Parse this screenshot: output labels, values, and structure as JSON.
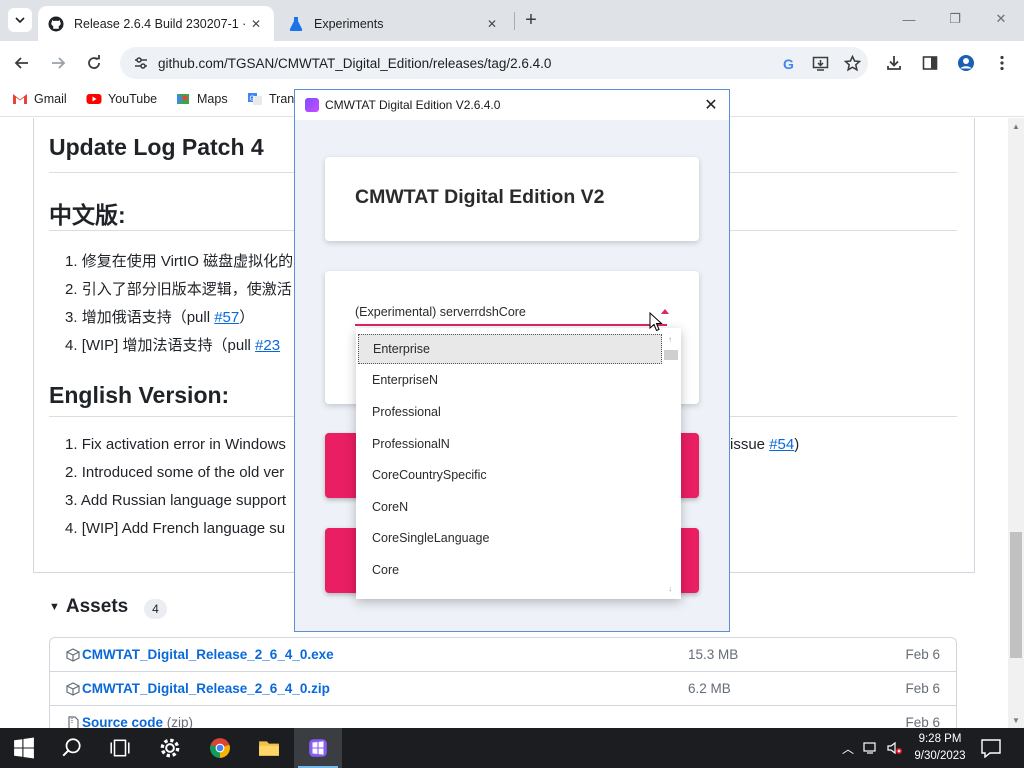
{
  "browser": {
    "tabs": [
      {
        "title": "Release 2.6.4 Build 230207-1 · T",
        "active": true
      },
      {
        "title": "Experiments",
        "active": false
      }
    ],
    "url": "github.com/TGSAN/CMWTAT_Digital_Edition/releases/tag/2.6.4.0",
    "bookmarks": [
      "Gmail",
      "YouTube",
      "Maps",
      "Translate"
    ]
  },
  "page": {
    "headings": {
      "update_log": "Update Log Patch 4",
      "chinese": "中文版:",
      "english": "English Version:"
    },
    "chinese_items": [
      {
        "num": "1.",
        "text": "修复在使用 VirtIO 磁盘虚拟化的"
      },
      {
        "num": "2.",
        "text": "引入了部分旧版本逻辑，使激活"
      },
      {
        "num": "3.",
        "text": "增加俄语支持（pull ",
        "link": "#57",
        "after": "）"
      },
      {
        "num": "4.",
        "text": "[WIP] 增加法语支持（pull ",
        "link": "#23"
      }
    ],
    "english_items": [
      {
        "num": "1.",
        "text": "Fix activation error in Windows",
        "tail": "issue ",
        "tail_link": "#54",
        "tail_after": ")"
      },
      {
        "num": "2.",
        "text": "Introduced some of the old ver"
      },
      {
        "num": "3.",
        "text": "Add Russian language support"
      },
      {
        "num": "4.",
        "text": "[WIP] Add French language su"
      }
    ],
    "assets": {
      "title": "Assets",
      "count": "4",
      "rows": [
        {
          "name": "CMWTAT_Digital_Release_2_6_4_0.exe",
          "size": "15.3 MB",
          "date": "Feb 6"
        },
        {
          "name": "CMWTAT_Digital_Release_2_6_4_0.zip",
          "size": "6.2 MB",
          "date": "Feb 6"
        },
        {
          "name": "Source code",
          "suffix": "(zip)",
          "size": "",
          "date": "Feb 6"
        }
      ]
    }
  },
  "dialog": {
    "window_title": "CMWTAT Digital Edition V2.6.4.0",
    "header_title": "CMWTAT Digital Edition V2",
    "selected_edition": "(Experimental) serverrdshCore",
    "dropdown_items": [
      "Enterprise",
      "EnterpriseN",
      "Professional",
      "ProfessionalN",
      "CoreCountrySpecific",
      "CoreN",
      "CoreSingleLanguage",
      "Core"
    ],
    "highlighted_item": "Enterprise",
    "accent_color": "#e91e63"
  },
  "taskbar": {
    "time": "9:28 PM",
    "date": "9/30/2023"
  }
}
